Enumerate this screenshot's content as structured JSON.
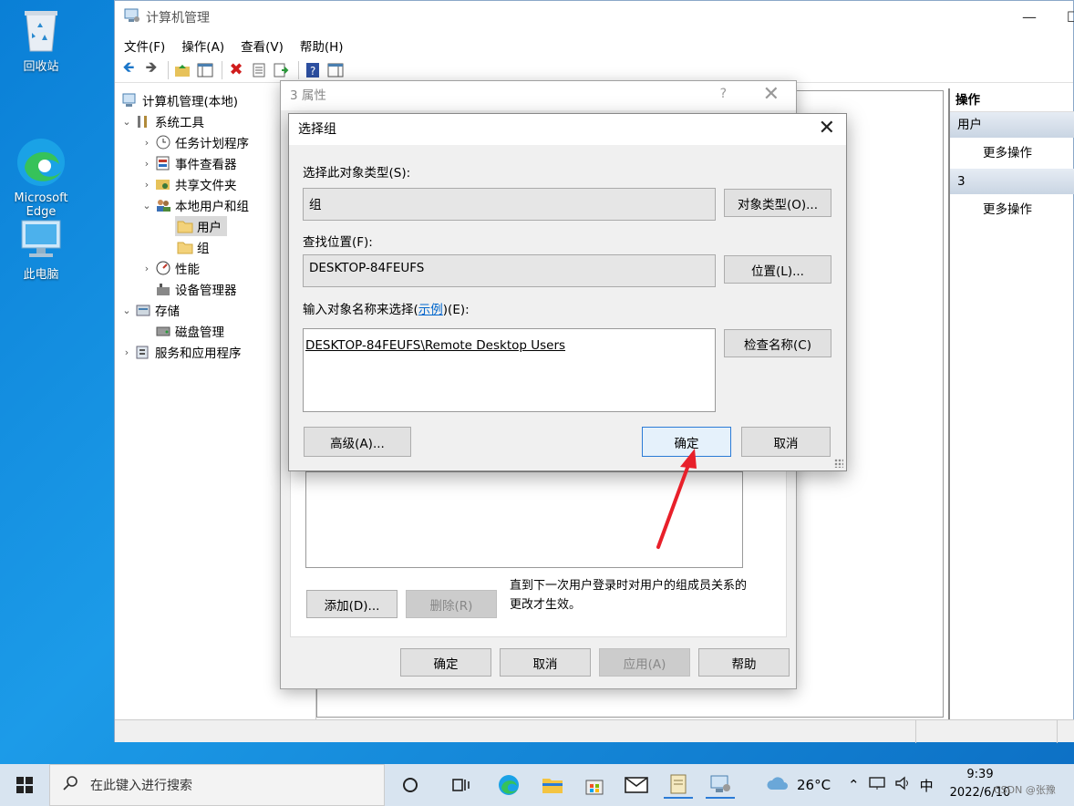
{
  "desktop": {
    "icons": [
      {
        "label": "回收站"
      },
      {
        "label": "Microsoft\nEdge"
      },
      {
        "label": "此电脑"
      }
    ]
  },
  "mmc": {
    "title": "计算机管理",
    "menus": [
      "文件(F)",
      "操作(A)",
      "查看(V)",
      "帮助(H)"
    ],
    "tree": [
      {
        "label": "计算机管理(本地)"
      },
      {
        "label": "系统工具"
      },
      {
        "label": "任务计划程序"
      },
      {
        "label": "事件查看器"
      },
      {
        "label": "共享文件夹"
      },
      {
        "label": "本地用户和组"
      },
      {
        "label": "用户"
      },
      {
        "label": "组"
      },
      {
        "label": "性能"
      },
      {
        "label": "设备管理器"
      },
      {
        "label": "存储"
      },
      {
        "label": "磁盘管理"
      },
      {
        "label": "服务和应用程序"
      }
    ],
    "actions": {
      "header": "操作",
      "section1": "用户",
      "item1": "更多操作",
      "section2": "3",
      "item2": "更多操作"
    }
  },
  "props_dialog": {
    "title": "3 属性",
    "help_glyph": "?",
    "close_glyph": "✕",
    "add_label": "添加(D)...",
    "remove_label": "删除(R)",
    "note": "直到下一次用户登录时对用户的组成员关系的更改才生效。",
    "ok_label": "确定",
    "cancel_label": "取消",
    "apply_label": "应用(A)",
    "help_label": "帮助"
  },
  "select_group_dialog": {
    "title": "选择组",
    "close_glyph": "✕",
    "object_type_label": "选择此对象类型(S):",
    "object_type_value": "组",
    "object_type_button": "对象类型(O)...",
    "location_label": "查找位置(F):",
    "location_value": "DESKTOP-84FEUFS",
    "location_button": "位置(L)...",
    "names_label_prefix": "输入对象名称来选择(",
    "names_label_link": "示例",
    "names_label_suffix": ")(E):",
    "names_value": "DESKTOP-84FEUFS\\Remote Desktop Users",
    "check_names_button": "检查名称(C)",
    "advanced_button": "高级(A)...",
    "ok_button": "确定",
    "cancel_button": "取消"
  },
  "taskbar": {
    "search_placeholder": "在此键入进行搜索",
    "weather": "26°C",
    "ime": "中",
    "time": "9:39",
    "date": "2022/6/10",
    "watermark": "CSDN @张豫"
  },
  "colors": {
    "desktop": "#0a7fd6",
    "accent": "#2b7bd6",
    "arrow": "#e8202a"
  }
}
